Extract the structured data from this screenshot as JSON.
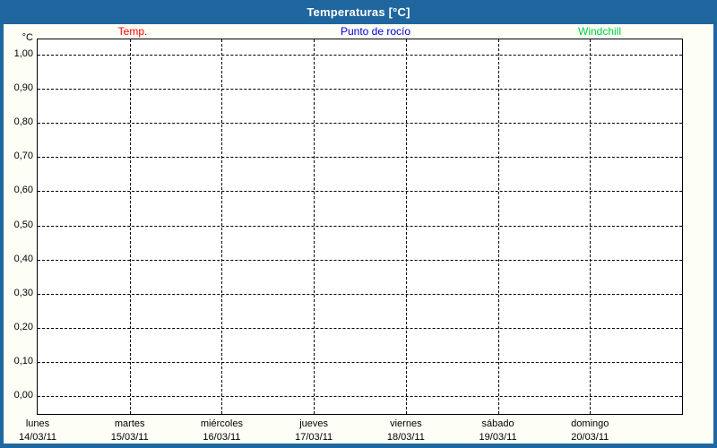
{
  "window": {
    "title": "Temperaturas [°C]"
  },
  "legend": {
    "items": [
      {
        "label": "Temp.",
        "color": "#ff0000"
      },
      {
        "label": "Punto de rocío",
        "color": "#0000dd"
      },
      {
        "label": "Windchill",
        "color": "#00cc44"
      }
    ]
  },
  "chart_data": {
    "type": "line",
    "title": "Temperaturas [°C]",
    "ylabel": "°C",
    "ylim": [
      0.0,
      1.0
    ],
    "ytick_labels": [
      "1,00",
      "0,90",
      "0,80",
      "0,70",
      "0,60",
      "0,50",
      "0,40",
      "0,30",
      "0,20",
      "0,10",
      "0,00"
    ],
    "ytick_values": [
      1.0,
      0.9,
      0.8,
      0.7,
      0.6,
      0.5,
      0.4,
      0.3,
      0.2,
      0.1,
      0.0
    ],
    "grid": "dashed",
    "legend_position": "top",
    "categories": [
      {
        "day": "lunes",
        "date": "14/03/11"
      },
      {
        "day": "martes",
        "date": "15/03/11"
      },
      {
        "day": "miércoles",
        "date": "16/03/11"
      },
      {
        "day": "jueves",
        "date": "17/03/11"
      },
      {
        "day": "viernes",
        "date": "18/03/11"
      },
      {
        "day": "sábado",
        "date": "19/03/11"
      },
      {
        "day": "domingo",
        "date": "20/03/11"
      }
    ],
    "series": [
      {
        "name": "Temp.",
        "color": "#ff0000",
        "values": []
      },
      {
        "name": "Punto de rocío",
        "color": "#0000dd",
        "values": []
      },
      {
        "name": "Windchill",
        "color": "#00cc44",
        "values": []
      }
    ]
  }
}
